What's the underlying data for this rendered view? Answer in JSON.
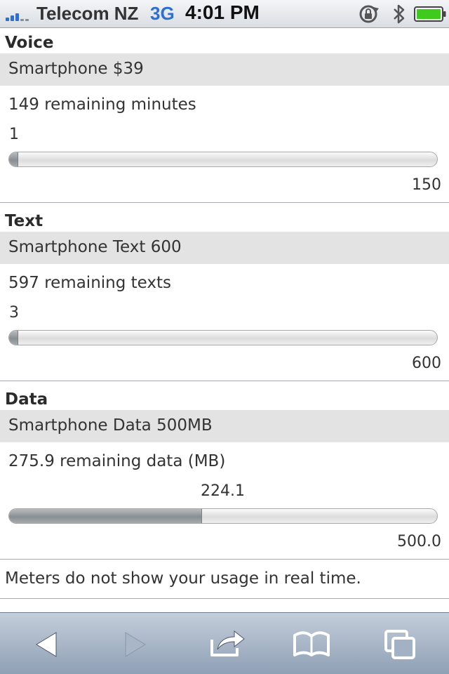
{
  "status_bar": {
    "carrier": "Telecom NZ",
    "network": "3G",
    "time": "4:01 PM",
    "icons": [
      "signal-strength-icon",
      "orientation-lock-icon",
      "bluetooth-icon",
      "battery-icon"
    ]
  },
  "sections": [
    {
      "title": "Voice",
      "plan": "Smartphone $39",
      "remaining": "149 remaining minutes",
      "used": "1",
      "max": "150",
      "used_fraction": 0.0067
    },
    {
      "title": "Text",
      "plan": "Smartphone Text 600",
      "remaining": "597 remaining texts",
      "used": "3",
      "max": "600",
      "used_fraction": 0.005
    },
    {
      "title": "Data",
      "plan": "Smartphone Data 500MB",
      "remaining": "275.9 remaining data (MB)",
      "used": "224.1",
      "max": "500.0",
      "used_fraction": 0.4482
    }
  ],
  "note": "Meters do not show your usage in real time.",
  "toolbar": {
    "icons": [
      "back-arrow-icon",
      "forward-arrow-icon",
      "share-icon",
      "bookmarks-icon",
      "pages-icon"
    ]
  },
  "colors": {
    "status_blue": "#2e6fd6",
    "battery_green": "#3ecb1e",
    "plan_bar_bg": "#e3e3e3",
    "toolbar_top": "#c4cedb",
    "toolbar_bottom": "#8f9fb5"
  }
}
